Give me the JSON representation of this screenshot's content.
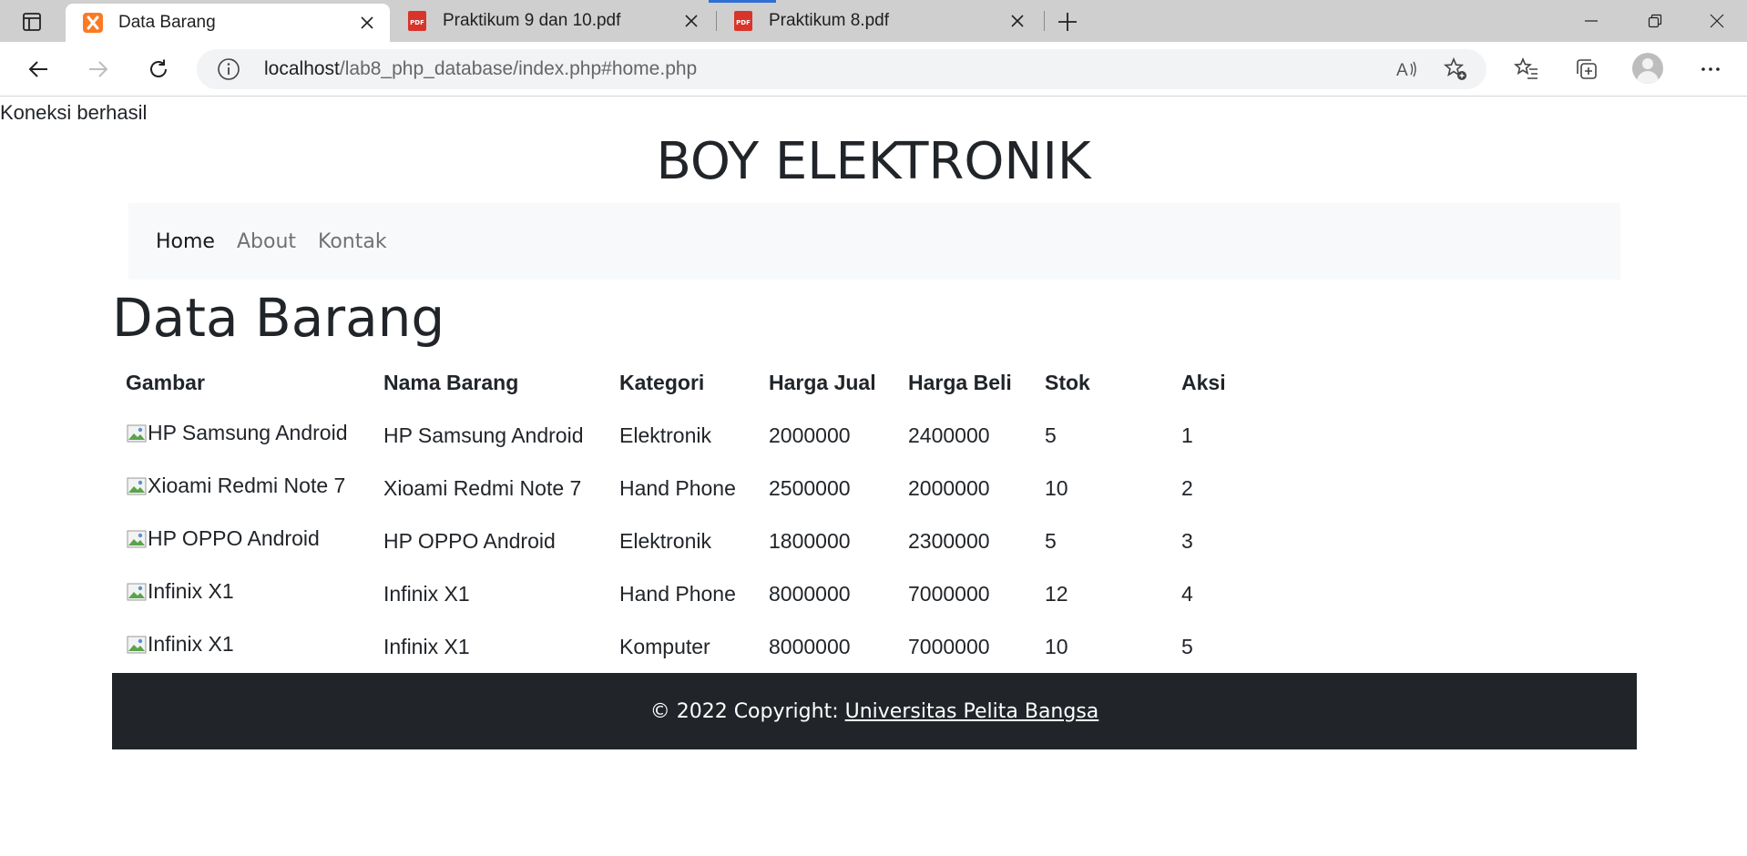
{
  "browser": {
    "tabs": [
      {
        "title": "Data Barang",
        "favicon": "xampp-icon",
        "active": true
      },
      {
        "title": "Praktikum 9 dan 10.pdf",
        "favicon": "pdf-icon",
        "active": false
      },
      {
        "title": "Praktikum 8.pdf",
        "favicon": "pdf-icon",
        "active": false
      }
    ],
    "url_host": "localhost",
    "url_path": "/lab8_php_database/index.php#home.php"
  },
  "page": {
    "connection_status": "Koneksi berhasil",
    "brand": "BOY ELEKTRONIK",
    "nav": [
      {
        "label": "Home",
        "active": true
      },
      {
        "label": "About",
        "active": false
      },
      {
        "label": "Kontak",
        "active": false
      }
    ],
    "heading": "Data Barang",
    "table": {
      "headers": [
        "Gambar",
        "Nama Barang",
        "Kategori",
        "Harga Jual",
        "Harga Beli",
        "Stok",
        "Aksi"
      ],
      "rows": [
        {
          "gambar_alt": "HP Samsung Android",
          "nama": "HP Samsung Android",
          "kategori": "Elektronik",
          "harga_jual": "2000000",
          "harga_beli": "2400000",
          "stok": "5",
          "aksi": "1"
        },
        {
          "gambar_alt": "Xioami Redmi Note 7",
          "nama": "Xioami Redmi Note 7",
          "kategori": "Hand Phone",
          "harga_jual": "2500000",
          "harga_beli": "2000000",
          "stok": "10",
          "aksi": "2"
        },
        {
          "gambar_alt": "HP OPPO Android",
          "nama": "HP OPPO Android",
          "kategori": "Elektronik",
          "harga_jual": "1800000",
          "harga_beli": "2300000",
          "stok": "5",
          "aksi": "3"
        },
        {
          "gambar_alt": "Infinix X1",
          "nama": "Infinix X1",
          "kategori": "Hand Phone",
          "harga_jual": "8000000",
          "harga_beli": "7000000",
          "stok": "12",
          "aksi": "4"
        },
        {
          "gambar_alt": "Infinix X1",
          "nama": "Infinix X1",
          "kategori": "Komputer",
          "harga_jual": "8000000",
          "harga_beli": "7000000",
          "stok": "10",
          "aksi": "5"
        }
      ]
    },
    "footer": {
      "prefix": "© 2022 Copyright: ",
      "link": "Universitas Pelita Bangsa"
    }
  }
}
